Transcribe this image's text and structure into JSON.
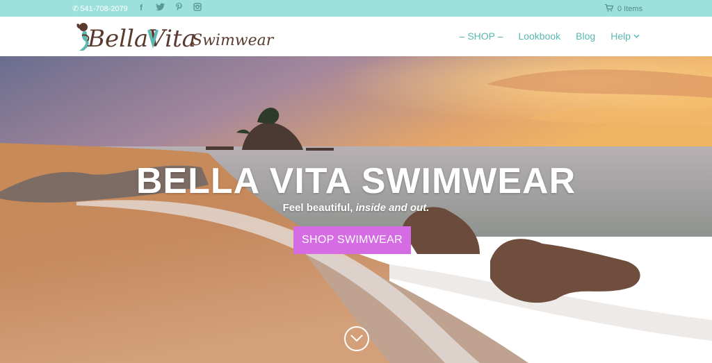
{
  "topbar": {
    "phone": "541-708-2079",
    "social_icons": [
      "facebook-icon",
      "twitter-icon",
      "pinterest-icon",
      "instagram-icon"
    ],
    "cart_label": "0 Items",
    "bg_color": "#9ee0dc"
  },
  "header": {
    "logo_text_main": "BellaVita",
    "logo_text_script": "Swimwear",
    "nav": [
      {
        "label": "– SHOP –"
      },
      {
        "label": "Lookbook"
      },
      {
        "label": "Blog"
      },
      {
        "label": "Help"
      }
    ],
    "nav_color": "#57b8b2"
  },
  "hero": {
    "title": "BELLA VITA SWIMWEAR",
    "subtitle_plain": "Feel beautiful, ",
    "subtitle_italic": "inside and out.",
    "button_label": "SHOP SWIMWEAR",
    "button_color": "#d66ce3"
  }
}
